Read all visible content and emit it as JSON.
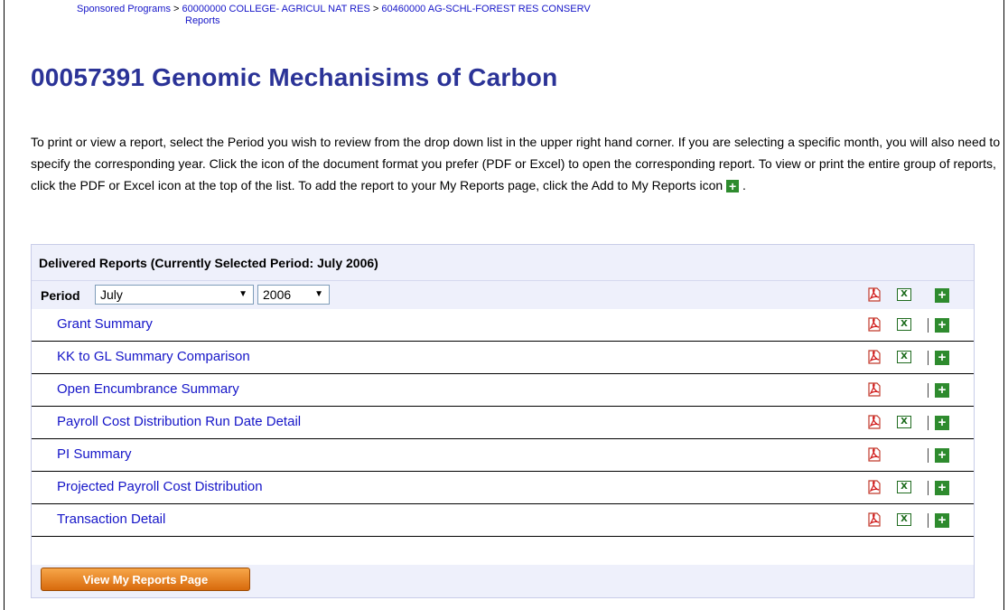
{
  "breadcrumb": {
    "items": [
      "Sponsored Programs",
      "60000000  COLLEGE- AGRICUL NAT RES",
      "60460000  AG-SCHL-FOREST RES CONSERV",
      "Reports"
    ],
    "separator": ">"
  },
  "page_title": "00057391  Genomic Mechanisims of Carbon",
  "instructions": {
    "text": "To print or view a report, select the Period you wish to review from the drop down list in the upper right hand corner. If you are selecting a specific month, you will also need to specify the corresponding year. Click the icon of the document format you prefer (PDF or Excel) to open the corresponding report. To view or print the entire group of reports, click the PDF or Excel icon at the top of the list. To add the report to your My Reports page, click the Add to My Reports icon",
    "suffix": " ."
  },
  "panel": {
    "header": "Delivered Reports (Currently Selected Period: July 2006)",
    "period_label": "Period",
    "month_value": "July",
    "year_value": "2006"
  },
  "reports": [
    {
      "name": "Grant Summary",
      "excel": true
    },
    {
      "name": "KK to GL Summary Comparison",
      "excel": true
    },
    {
      "name": "Open Encumbrance Summary",
      "excel": false
    },
    {
      "name": "Payroll Cost Distribution Run Date Detail",
      "excel": true
    },
    {
      "name": "PI Summary",
      "excel": false
    },
    {
      "name": "Projected Payroll Cost Distribution",
      "excel": true
    },
    {
      "name": "Transaction Detail",
      "excel": true
    }
  ],
  "button": {
    "label": "View My Reports Page"
  },
  "icons": {
    "pdf": "pdf-icon",
    "excel": "excel-icon",
    "add": "add-to-my-reports-icon"
  },
  "colors": {
    "link": "#1515c8",
    "title": "#2b3397",
    "panel_bg": "#eef0fb",
    "add_green": "#2e8b2e",
    "button_orange": "#e47f1e"
  }
}
